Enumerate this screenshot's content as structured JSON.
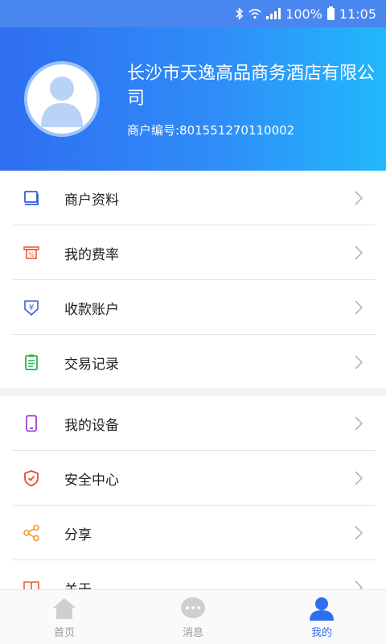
{
  "status_bar": {
    "battery": "100%",
    "time": "11:05"
  },
  "profile": {
    "merchant_name": "长沙市天逸高品商务酒店有限公司",
    "merchant_no": "商户编号:801551270110002"
  },
  "menu": {
    "group1": [
      {
        "label": "商户资料",
        "icon": "merchant-info-icon",
        "color": "#2d62d8"
      },
      {
        "label": "我的费率",
        "icon": "rate-icon",
        "color": "#f05a3c"
      },
      {
        "label": "收款账户",
        "icon": "account-icon",
        "color": "#3b62d8"
      },
      {
        "label": "交易记录",
        "icon": "records-icon",
        "color": "#2bb24c"
      }
    ],
    "group2": [
      {
        "label": "我的设备",
        "icon": "device-icon",
        "color": "#9b3fd0"
      },
      {
        "label": "安全中心",
        "icon": "shield-icon",
        "color": "#f0452f"
      },
      {
        "label": "分享",
        "icon": "share-icon",
        "color": "#f59a23"
      },
      {
        "label": "关于",
        "icon": "book-icon",
        "color": "#f05a3c"
      }
    ]
  },
  "tabs": [
    {
      "label": "首页",
      "icon": "home-icon",
      "active": false
    },
    {
      "label": "消息",
      "icon": "message-icon",
      "active": false
    },
    {
      "label": "我的",
      "icon": "user-icon",
      "active": true
    }
  ],
  "colors": {
    "accent": "#2f6ef0",
    "header_end": "#22b8fb"
  }
}
